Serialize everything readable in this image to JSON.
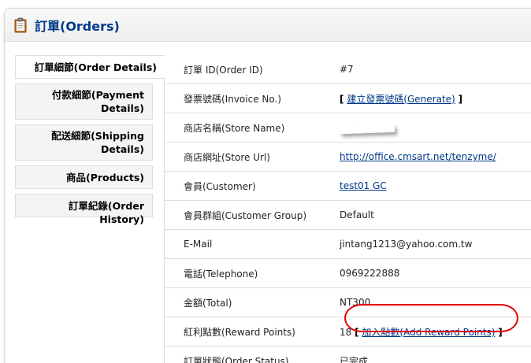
{
  "header": {
    "title": "訂單(Orders)",
    "icon": "clipboard-icon"
  },
  "tabs": [
    {
      "label": "訂單細節(Order Details)",
      "active": true
    },
    {
      "label": "付款細節(Payment Details)",
      "active": false
    },
    {
      "label": "配送細節(Shipping Details)",
      "active": false
    },
    {
      "label": "商品(Products)",
      "active": false
    },
    {
      "label": "訂單紀錄(Order History)",
      "active": false
    }
  ],
  "details": {
    "order_id": {
      "label": "訂單 ID(Order ID)",
      "value": "#7"
    },
    "invoice": {
      "label": "發票號碼(Invoice No.)",
      "link": "建立發票號碼(Generate)",
      "open": "[",
      "close": "]"
    },
    "store_name": {
      "label": "商店名稱(Store Name)",
      "value": ""
    },
    "store_url": {
      "label": "商店網址(Store Url)",
      "link": "http://office.cmsart.net/tenzyme/"
    },
    "customer": {
      "label": "會員(Customer)",
      "link": "test01 GC"
    },
    "customer_group": {
      "label": "會員群組(Customer Group)",
      "value": "Default"
    },
    "email": {
      "label": "E-Mail",
      "value": "jintang1213@yahoo.com.tw"
    },
    "telephone": {
      "label": "電話(Telephone)",
      "value": "0969222888"
    },
    "total": {
      "label": "金額(Total)",
      "value": "NT300"
    },
    "reward": {
      "label": "紅利點數(Reward Points)",
      "value": "18",
      "open": "[",
      "link": "加入點數(Add Reward Points)",
      "close": "]"
    },
    "status": {
      "label": "訂單狀態(Order Status)",
      "value": "已完成"
    }
  },
  "colors": {
    "title": "#003a88",
    "link": "#003a88",
    "highlight": "#e60000"
  }
}
